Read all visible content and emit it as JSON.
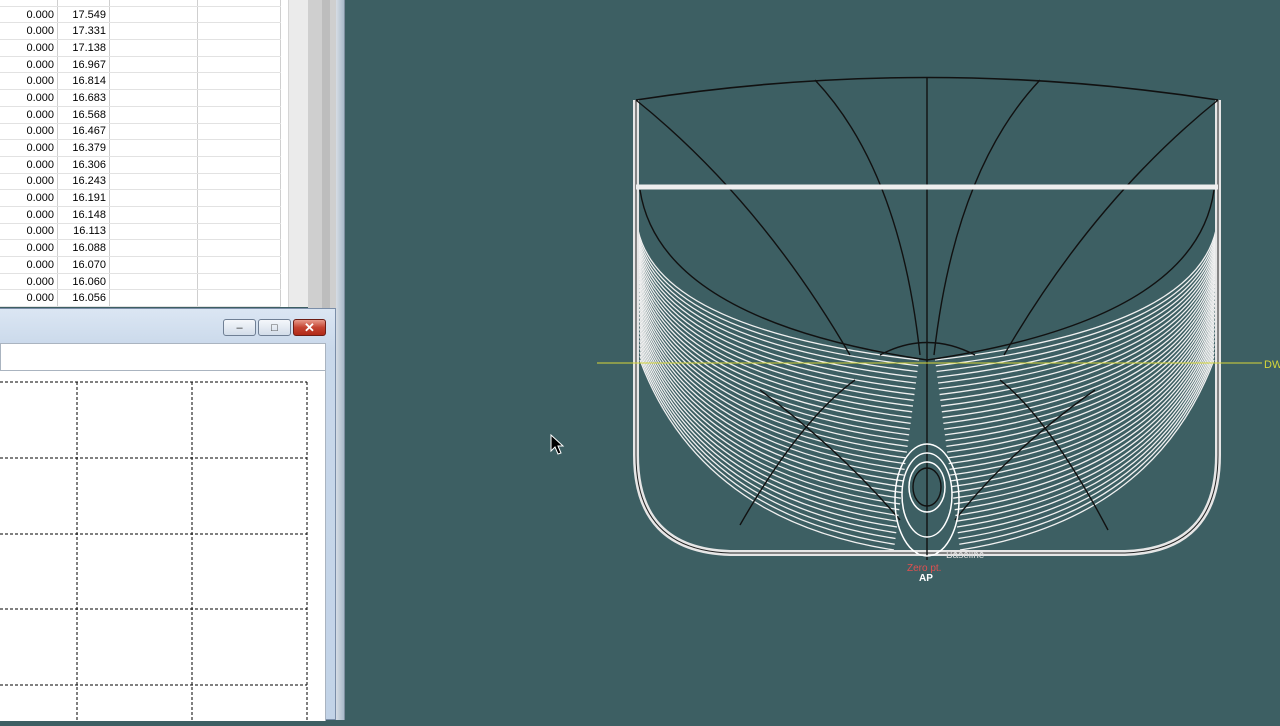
{
  "table": {
    "rows": [
      {
        "a": "0.000",
        "b": "17.549"
      },
      {
        "a": "0.000",
        "b": "17.331"
      },
      {
        "a": "0.000",
        "b": "17.138"
      },
      {
        "a": "0.000",
        "b": "16.967"
      },
      {
        "a": "0.000",
        "b": "16.814"
      },
      {
        "a": "0.000",
        "b": "16.683"
      },
      {
        "a": "0.000",
        "b": "16.568"
      },
      {
        "a": "0.000",
        "b": "16.467"
      },
      {
        "a": "0.000",
        "b": "16.379"
      },
      {
        "a": "0.000",
        "b": "16.306"
      },
      {
        "a": "0.000",
        "b": "16.243"
      },
      {
        "a": "0.000",
        "b": "16.191"
      },
      {
        "a": "0.000",
        "b": "16.148"
      },
      {
        "a": "0.000",
        "b": "16.113"
      },
      {
        "a": "0.000",
        "b": "16.088"
      },
      {
        "a": "0.000",
        "b": "16.070"
      },
      {
        "a": "0.000",
        "b": "16.060"
      },
      {
        "a": "0.000",
        "b": "16.056"
      }
    ]
  },
  "child_window": {
    "minimize_label": "–",
    "maximize_label": "□",
    "close_label": "✕"
  },
  "view": {
    "waterline_label": "DW",
    "baseline_label": "Baseline",
    "zero_point_label": "Zero pt.",
    "ap_label": "AP"
  },
  "colors": {
    "background": "#3d5f63",
    "waterline": "#d6d63a",
    "zero_point": "#e05050",
    "hull_lines": "#f2f2f2",
    "close_button": "#c44331"
  },
  "icons": {
    "cursor": "arrow-cursor-icon"
  }
}
